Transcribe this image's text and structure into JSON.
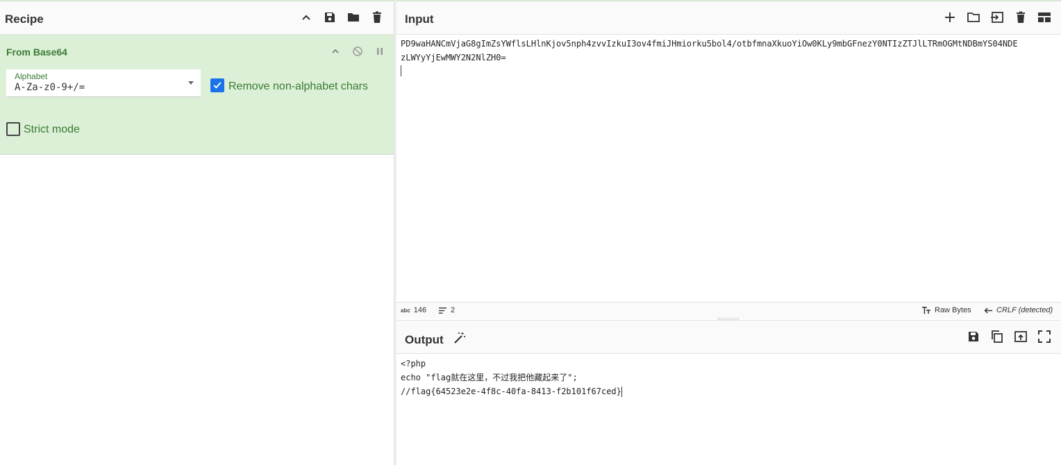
{
  "recipe": {
    "title": "Recipe",
    "operation": {
      "name": "From Base64",
      "alphabet_label": "Alphabet",
      "alphabet_value": "A-Za-z0-9+/=",
      "remove_non_alphabet_label": "Remove non-alphabet chars",
      "remove_non_alphabet_checked": true,
      "strict_mode_label": "Strict mode",
      "strict_mode_checked": false
    }
  },
  "input": {
    "title": "Input",
    "lines": [
      "PD9waHANCmVjaG8gImZsYWflsLHlnKjov5nph4zvvIzkuI3ov4fmiJHmiorku5bol4/otbfmnaXkuoYiOw0KLy9mbGFnezY0NTIzZTJlLTRmOGMtNDBmYS04NDE",
      "zLWYyYjEwMWY2N2NlZH0="
    ],
    "status": {
      "length_icon": "abc",
      "length": "146",
      "lines_count": "2",
      "encoding": "Raw Bytes",
      "eol": "CRLF (detected)"
    }
  },
  "output": {
    "title": "Output",
    "lines": [
      "<?php",
      "echo \"flag就在这里，不过我把他藏起来了\";",
      "//flag{64523e2e-4f8c-40fa-8413-f2b101f67ced}"
    ]
  },
  "colors": {
    "accent_green": "#3a7b34",
    "card_green": "#dcefd7",
    "checkbox_blue": "#1a73e8"
  }
}
